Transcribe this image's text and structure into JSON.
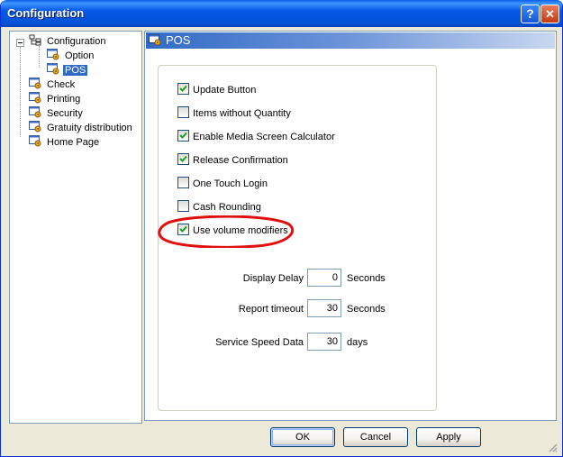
{
  "window": {
    "title": "Configuration",
    "help_label": "?",
    "close_label": "✕"
  },
  "tree": {
    "root": {
      "label": "Configuration",
      "icon": "config-tree-icon",
      "expanded": true
    },
    "children": [
      {
        "label": "Option",
        "icon": "settings-gear-icon"
      },
      {
        "label": "POS",
        "icon": "settings-gear-icon",
        "selected": true
      }
    ],
    "items": [
      {
        "label": "Check",
        "icon": "settings-gear-icon"
      },
      {
        "label": "Printing",
        "icon": "settings-gear-icon"
      },
      {
        "label": "Security",
        "icon": "settings-gear-icon"
      },
      {
        "label": "Gratuity distribution",
        "icon": "settings-gear-icon"
      },
      {
        "label": "Home Page",
        "icon": "settings-gear-icon"
      }
    ]
  },
  "panel": {
    "title": "POS",
    "checkboxes": [
      {
        "label": "Update Button",
        "checked": true
      },
      {
        "label": "Items without Quantity",
        "checked": false
      },
      {
        "label": "Enable Media Screen Calculator",
        "checked": true
      },
      {
        "label": "Release Confirmation",
        "checked": true
      },
      {
        "label": "One Touch Login",
        "checked": false
      },
      {
        "label": "Cash Rounding",
        "checked": false
      },
      {
        "label": "Use volume modifiers",
        "checked": true,
        "highlighted": true
      }
    ],
    "fields": [
      {
        "label": "Display Delay",
        "value": "0",
        "unit": "Seconds"
      },
      {
        "label": "Report timeout",
        "value": "30",
        "unit": "Seconds"
      },
      {
        "label": "Service Speed Data",
        "value": "30",
        "unit": "days"
      }
    ]
  },
  "buttons": {
    "ok": "OK",
    "cancel": "Cancel",
    "apply": "Apply"
  },
  "colors": {
    "titlebar": "#0553D8",
    "selection": "#316AC5",
    "check": "#21A121",
    "annotation": "#E01010"
  }
}
